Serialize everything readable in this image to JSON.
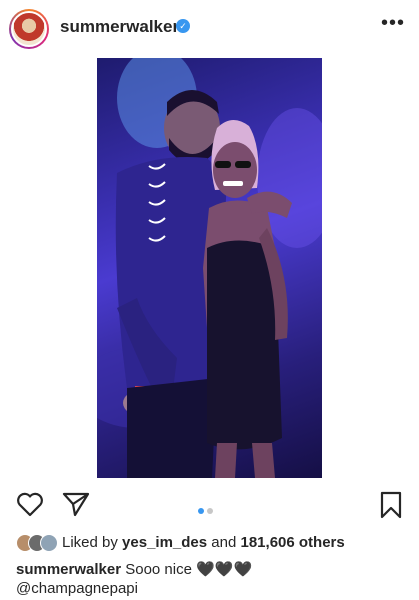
{
  "post": {
    "username": "summerwalker",
    "verified_icon": "verified-badge-icon",
    "more_label": "•••",
    "image_description_icon": "photo",
    "carousel": {
      "current": 1,
      "total": 2
    },
    "likes": {
      "prefix": "Liked by",
      "user": "yes_im_des",
      "joiner": "and",
      "others_count": "181,606 others"
    },
    "caption": {
      "username": "summerwalker",
      "text": "Sooo nice",
      "emoji": "🖤🖤🖤"
    },
    "mention": "@champagnepapi"
  },
  "colors": {
    "accent_blue": "#3897f0",
    "text": "#262626"
  }
}
